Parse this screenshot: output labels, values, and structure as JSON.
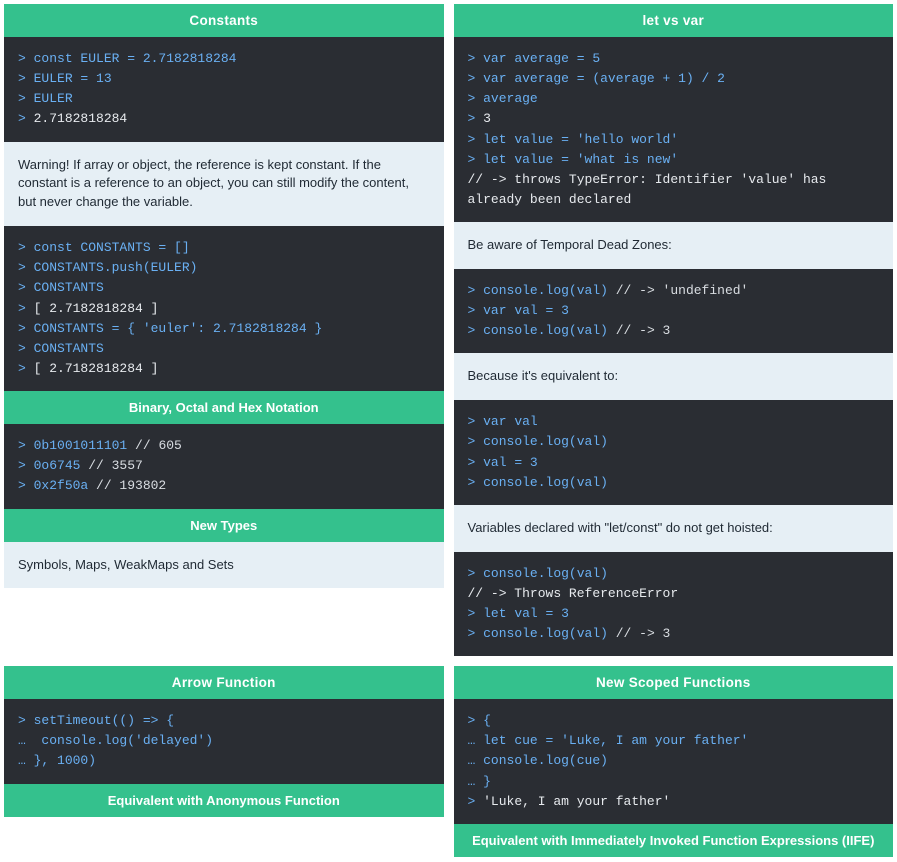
{
  "left": {
    "constants": {
      "title": "Constants",
      "code1": [
        {
          "prompt": "> ",
          "blue": "const EULER = 2.7182818284"
        },
        {
          "prompt": "> ",
          "blue": "EULER = 13"
        },
        {
          "prompt": "> ",
          "blue": "EULER"
        },
        {
          "prompt": "> ",
          "white": "2.7182818284"
        }
      ],
      "warning": "Warning! If array or object, the reference is kept constant. If the constant is a reference to an object, you can still modify the content, but never change the variable.",
      "code2": [
        {
          "prompt": "> ",
          "blue": "const CONSTANTS = []"
        },
        {
          "prompt": "> ",
          "blue": "CONSTANTS.push(EULER)"
        },
        {
          "prompt": "> ",
          "blue": "CONSTANTS"
        },
        {
          "prompt": "> ",
          "white": "[ 2.7182818284 ]"
        },
        {
          "prompt": "> ",
          "blue": "CONSTANTS = { 'euler': 2.7182818284 }"
        },
        {
          "prompt": "> ",
          "blue": "CONSTANTS"
        },
        {
          "prompt": "> ",
          "white": "[ 2.7182818284 ]"
        }
      ]
    },
    "binary": {
      "title": "Binary, Octal and Hex Notation",
      "code": [
        {
          "prompt": "> ",
          "blue": "0b1001011101",
          "comment": " // 605"
        },
        {
          "prompt": "> ",
          "blue": "0o6745",
          "comment": " // 3557"
        },
        {
          "prompt": "> ",
          "blue": "0x2f50a",
          "comment": " // 193802"
        }
      ]
    },
    "newtypes": {
      "title": "New Types",
      "note": "Symbols, Maps, WeakMaps and Sets"
    },
    "arrow": {
      "title": "Arrow Function",
      "code": [
        {
          "prompt": "> ",
          "blue": "setTimeout(() => {"
        },
        {
          "prompt": "…  ",
          "blue": "console.log('delayed')"
        },
        {
          "prompt": "… ",
          "blue": "}, 1000)"
        }
      ],
      "footer": "Equivalent with Anonymous Function"
    }
  },
  "right": {
    "letvar": {
      "title": "let vs var",
      "code1": [
        {
          "prompt": "> ",
          "blue": "var average = 5"
        },
        {
          "prompt": "> ",
          "blue": "var average = (average + 1) / 2"
        },
        {
          "prompt": "> ",
          "blue": "average"
        },
        {
          "prompt": "> ",
          "white": "3"
        },
        {
          "prompt": "> ",
          "blue": "let value = 'hello world'"
        },
        {
          "prompt": "> ",
          "blue": "let value = 'what is new'"
        },
        {
          "white": "// -> throws TypeError: Identifier 'value' has already been declared"
        }
      ],
      "note1": "Be aware of Temporal Dead Zones:",
      "code2": [
        {
          "prompt": "> ",
          "blue": "console.log(val)",
          "comment": " // -> 'undefined'"
        },
        {
          "prompt": "> ",
          "blue": "var val = 3"
        },
        {
          "prompt": "> ",
          "blue": "console.log(val)",
          "comment": " // -> 3"
        }
      ],
      "note2": "Because it's equivalent to:",
      "code3": [
        {
          "prompt": "> ",
          "blue": "var val"
        },
        {
          "prompt": "> ",
          "blue": "console.log(val)"
        },
        {
          "prompt": "> ",
          "blue": "val = 3"
        },
        {
          "prompt": "> ",
          "blue": "console.log(val)"
        }
      ],
      "note3": "Variables declared with \"let/const\" do not get hoisted:",
      "code4": [
        {
          "prompt": "> ",
          "blue": "console.log(val)"
        },
        {
          "white": "// -> Throws ReferenceError"
        },
        {
          "prompt": "> ",
          "blue": "let val = 3"
        },
        {
          "prompt": "> ",
          "blue": "console.log(val)",
          "comment": " // -> 3"
        }
      ]
    },
    "scoped": {
      "title": "New Scoped Functions",
      "code": [
        {
          "prompt": "> ",
          "blue": "{"
        },
        {
          "prompt": "… ",
          "blue": "let cue = 'Luke, I am your father'"
        },
        {
          "prompt": "… ",
          "blue": "console.log(cue)"
        },
        {
          "prompt": "… ",
          "blue": "}"
        },
        {
          "prompt": "> ",
          "white": "'Luke, I am your father'"
        }
      ],
      "footer": "Equivalent with Immediately Invoked Function Expressions (IIFE)"
    }
  }
}
